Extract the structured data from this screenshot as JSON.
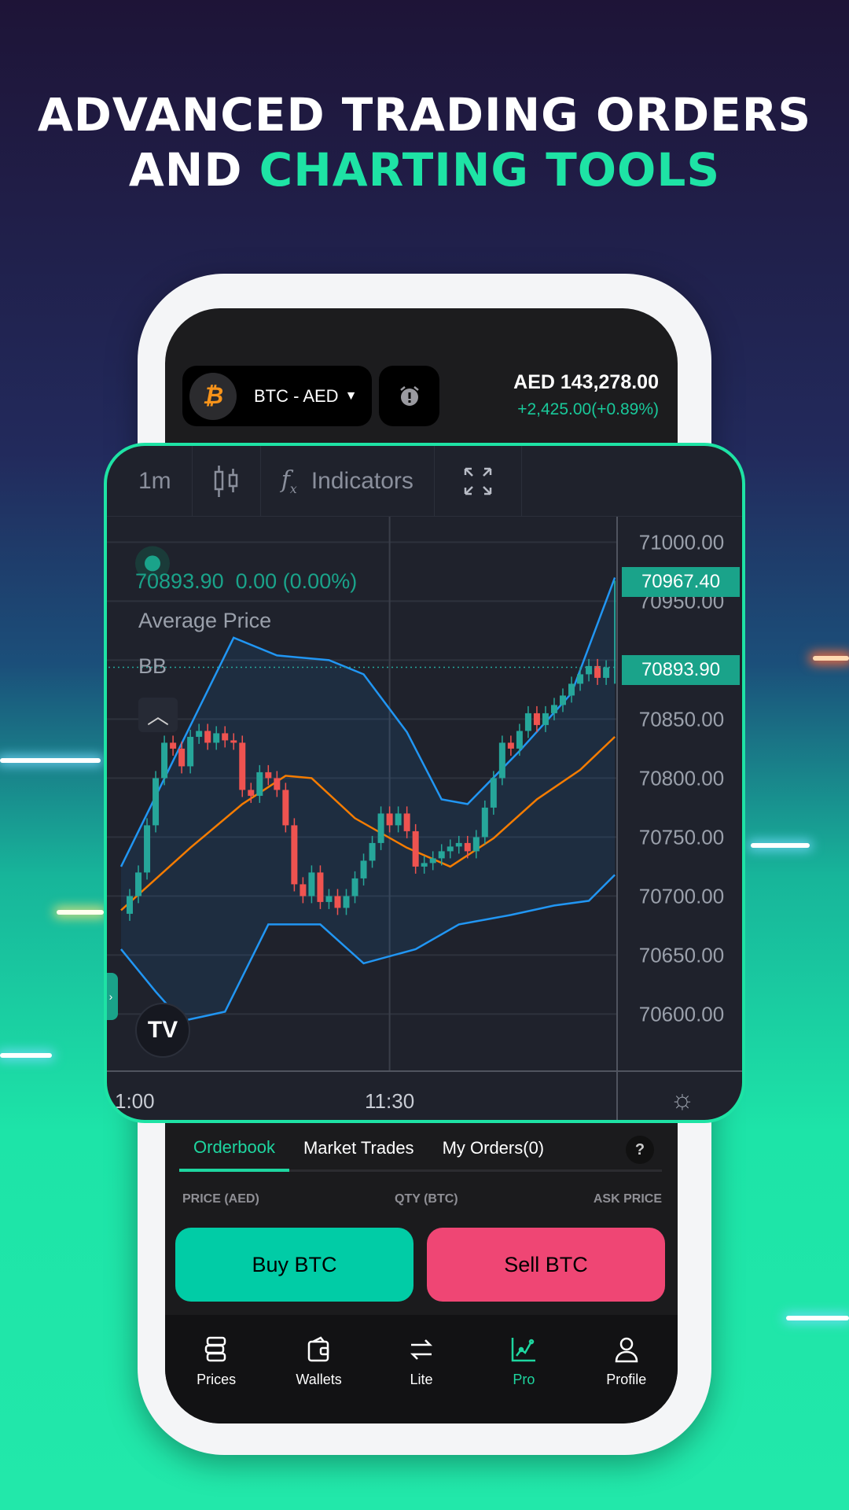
{
  "headline": {
    "line1": "ADVANCED TRADING ORDERS",
    "line2_plain": "AND ",
    "line2_accent": "CHARTING TOOLS"
  },
  "header": {
    "pair": "BTC - AED",
    "coin_icon": "bitcoin-icon",
    "price": "AED 143,278.00",
    "change": "+2,425.00(+0.89%)"
  },
  "toolbar": {
    "interval": "1m",
    "indicators": "Indicators"
  },
  "chart_legend": {
    "values": "70893.90  0.00 (0.00%)",
    "study1": "Average Price",
    "study2": "BB"
  },
  "chart_data": {
    "type": "candlestick",
    "interval": "1m",
    "price_ticks": [
      "71000.00",
      "70950.00",
      "70850.00",
      "70800.00",
      "70750.00",
      "70700.00",
      "70650.00",
      "70600.00"
    ],
    "time_ticks": [
      "1:00",
      "11:30"
    ],
    "last_price": "70967.40",
    "current_price": "70893.90",
    "closes": [
      70700,
      70720,
      70760,
      70800,
      70830,
      70825,
      70810,
      70835,
      70840,
      70830,
      70838,
      70832,
      70830,
      70790,
      70785,
      70805,
      70800,
      70790,
      70760,
      70710,
      70700,
      70720,
      70695,
      70700,
      70690,
      70700,
      70715,
      70730,
      70745,
      70770,
      70760,
      70770,
      70755,
      70725,
      70728,
      70732,
      70738,
      70742,
      70745,
      70738,
      70750,
      70775,
      70800,
      70830,
      70825,
      70840,
      70855,
      70845,
      70855,
      70862,
      70870,
      70880,
      70888,
      70895,
      70885,
      70893.9
    ],
    "bb_upper": [
      [
        "10:59",
        70725
      ],
      [
        "11:12",
        70919
      ],
      [
        "11:17",
        70904
      ],
      [
        "11:23",
        70900
      ],
      [
        "11:27",
        70888
      ],
      [
        "11:32",
        70839
      ],
      [
        "11:36",
        70782
      ],
      [
        "11:39",
        70778
      ],
      [
        "11:45",
        70823
      ],
      [
        "11:51",
        70872
      ],
      [
        "11:56",
        70970
      ]
    ],
    "bb_basis": [
      [
        "10:59",
        70688
      ],
      [
        "11:07",
        70741
      ],
      [
        "11:13",
        70778
      ],
      [
        "11:18",
        70802
      ],
      [
        "11:21",
        70800
      ],
      [
        "11:26",
        70766
      ],
      [
        "11:32",
        70741
      ],
      [
        "11:37",
        70725
      ],
      [
        "11:42",
        70749
      ],
      [
        "11:47",
        70782
      ],
      [
        "11:52",
        70807
      ],
      [
        "11:56",
        70835
      ]
    ],
    "bb_lower": [
      [
        "10:59",
        70655
      ],
      [
        "11:03",
        70619
      ],
      [
        "11:06",
        70594
      ],
      [
        "11:11",
        70602
      ],
      [
        "11:16",
        70676
      ],
      [
        "11:22",
        70676
      ],
      [
        "11:27",
        70643
      ],
      [
        "11:33",
        70655
      ],
      [
        "11:38",
        70676
      ],
      [
        "11:44",
        70684
      ],
      [
        "11:49",
        70692
      ],
      [
        "11:53",
        70696
      ],
      [
        "11:56",
        70718
      ]
    ],
    "colors": {
      "up": "#26a69a",
      "down": "#ef5350",
      "bb": "#2196f3",
      "basis": "#f57c00"
    }
  },
  "orders": {
    "tabs": [
      "Orderbook",
      "Market Trades",
      "My Orders(0)"
    ],
    "help": "?",
    "cols": [
      "PRICE (AED)",
      "QTY (BTC)",
      "ASK PRICE"
    ],
    "buy": "Buy BTC",
    "sell": "Sell BTC"
  },
  "nav": [
    {
      "label": "Prices"
    },
    {
      "label": "Wallets"
    },
    {
      "label": "Lite"
    },
    {
      "label": "Pro"
    },
    {
      "label": "Profile"
    }
  ]
}
